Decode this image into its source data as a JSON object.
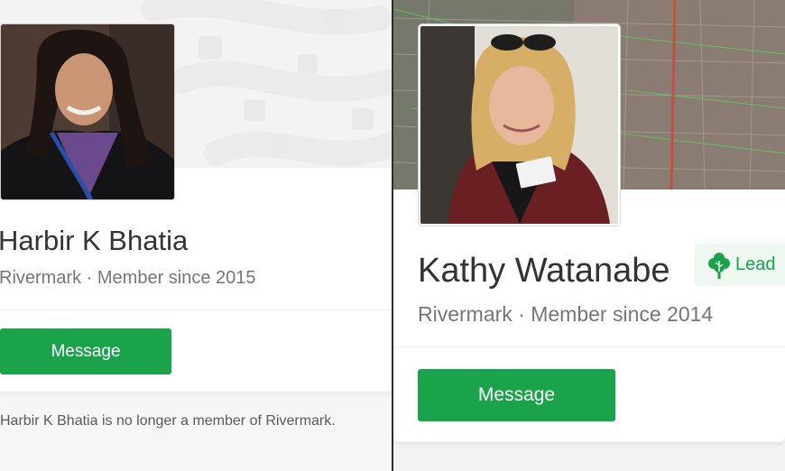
{
  "left_profile": {
    "name": "Harbir K Bhatia",
    "subtitle": "Rivermark · Member since 2015",
    "message_label": "Message",
    "status_note": "Harbir K Bhatia is no longer a member of Rivermark."
  },
  "right_profile": {
    "name": "Kathy Watanabe",
    "badge_label": "Lead",
    "subtitle": "Rivermark · Member since 2014",
    "message_label": "Message"
  },
  "icons": {
    "lead_badge": "tree-icon"
  },
  "colors": {
    "accent_green": "#1aa34a",
    "badge_background": "#eef8f1",
    "name_text": "#333333",
    "subtitle_text": "#767676"
  }
}
